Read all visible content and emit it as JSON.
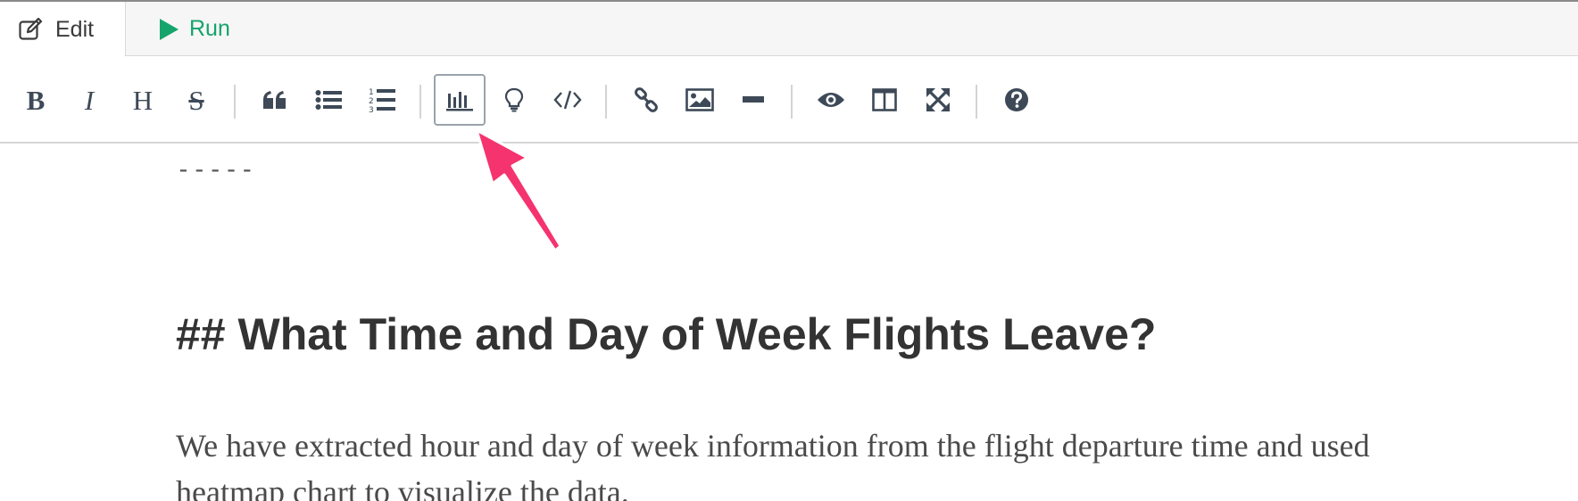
{
  "tabs": {
    "edit": {
      "label": "Edit",
      "icon": "edit-icon"
    },
    "run": {
      "label": "Run",
      "icon": "play-icon",
      "color": "#15a46b"
    }
  },
  "toolbar": {
    "buttons": [
      {
        "name": "bold",
        "icon": "bold-icon",
        "glyph": "B"
      },
      {
        "name": "italic",
        "icon": "italic-icon",
        "glyph": "I"
      },
      {
        "name": "heading",
        "icon": "heading-icon",
        "glyph": "H"
      },
      {
        "name": "strikethrough",
        "icon": "strikethrough-icon",
        "glyph": "S"
      },
      {
        "name": "quote",
        "icon": "quote-icon"
      },
      {
        "name": "unordered-list",
        "icon": "bullet-list-icon"
      },
      {
        "name": "ordered-list",
        "icon": "numbered-list-icon"
      },
      {
        "name": "chart",
        "icon": "bar-chart-icon",
        "active": true
      },
      {
        "name": "hint",
        "icon": "lightbulb-icon"
      },
      {
        "name": "code",
        "icon": "code-icon"
      },
      {
        "name": "link",
        "icon": "link-icon"
      },
      {
        "name": "image",
        "icon": "image-icon"
      },
      {
        "name": "horizontal-rule",
        "icon": "minus-icon"
      },
      {
        "name": "preview",
        "icon": "eye-icon"
      },
      {
        "name": "side-by-side",
        "icon": "columns-icon"
      },
      {
        "name": "fullscreen",
        "icon": "expand-icon"
      },
      {
        "name": "guide",
        "icon": "question-icon"
      }
    ],
    "accent_border": "#9aa3ab"
  },
  "editor": {
    "rule_text": "-----",
    "heading_text": "## What Time and Day of Week Flights Leave?",
    "paragraph_text": "We have extracted hour and day of week information from the flight departure time and used heatmap chart to visualize the data."
  },
  "annotation": {
    "arrow_color": "#f5336f",
    "icon": "pointer-arrow"
  }
}
